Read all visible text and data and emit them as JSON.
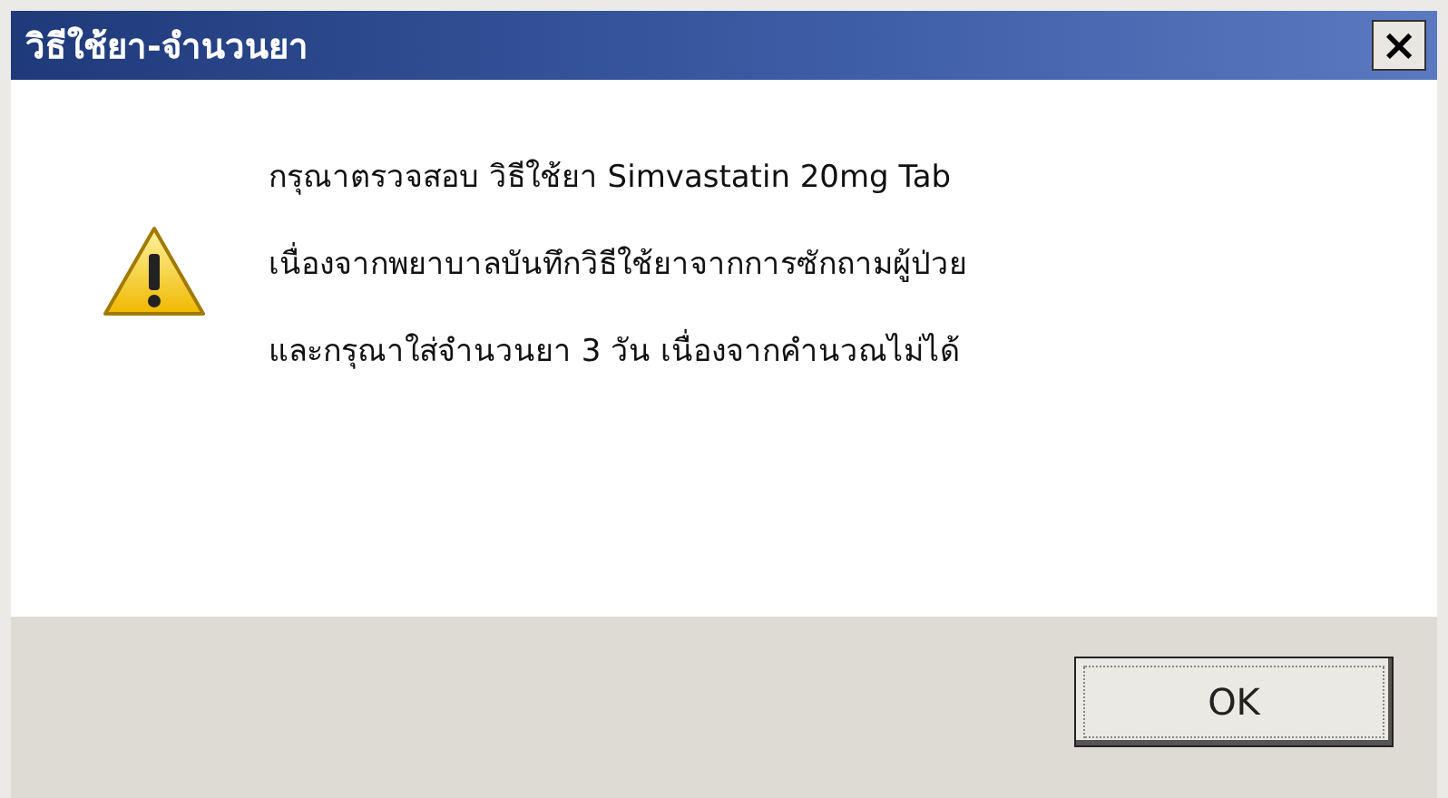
{
  "window": {
    "title": "วิธีใช้ยา-จำนวนยา",
    "close_label": "×"
  },
  "message": {
    "lines": [
      "กรุณาตรวจสอบ วิธีใช้ยา Simvastatin 20mg Tab",
      "เนื่องจากพยาบาลบันทึกวิธีใช้ยาจากการซักถามผู้ป่วย",
      "และกรุณาใส่จำนวนยา 3 วัน เนื่องจากคำนวณไม่ได้"
    ],
    "kind": "warning"
  },
  "buttons": [
    {
      "label": "OK",
      "default": true
    }
  ]
}
